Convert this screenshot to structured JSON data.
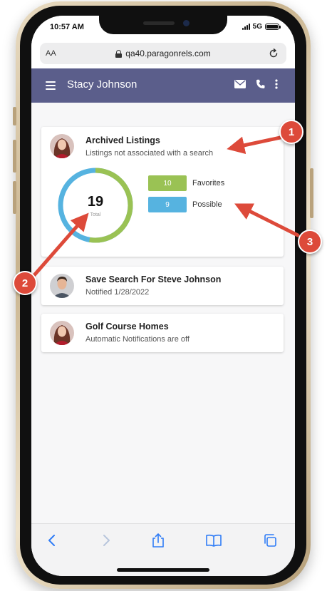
{
  "status_bar": {
    "time": "10:57 AM",
    "network": "5G"
  },
  "browser": {
    "text_size_label": "AA",
    "url": "qa40.paragonrels.com"
  },
  "app_bar": {
    "user_name": "Stacy Johnson"
  },
  "cards": [
    {
      "title": "Archived Listings",
      "subtitle": "Listings not associated with a search",
      "donut": {
        "total": "19",
        "total_label": "Total"
      },
      "legend": [
        {
          "value": "10",
          "label": "Favorites",
          "color": "#9ac254"
        },
        {
          "value": "9",
          "label": "Possible",
          "color": "#56b3e0"
        }
      ]
    },
    {
      "title": "Save Search For Steve Johnson",
      "subtitle": "Notified 1/28/2022"
    },
    {
      "title": "Golf Course Homes",
      "subtitle": "Automatic Notifications are off"
    }
  ],
  "callouts": [
    "1",
    "2",
    "3"
  ],
  "colors": {
    "app_bar": "#5b5e8b",
    "favorites": "#9ac254",
    "possible": "#56b3e0",
    "callout": "#dd4a3a",
    "ios_blue": "#2f7cf6"
  },
  "icons": {
    "app_bar": [
      "menu-icon",
      "mail-icon",
      "phone-icon",
      "more-vertical-icon"
    ],
    "browser": [
      "lock-icon",
      "reload-icon"
    ],
    "toolbar": [
      "back-icon",
      "forward-icon",
      "share-icon",
      "bookmarks-icon",
      "tabs-icon"
    ]
  }
}
